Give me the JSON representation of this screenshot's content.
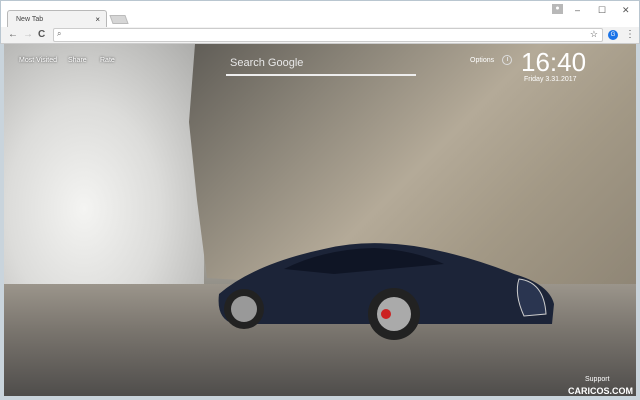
{
  "browser": {
    "tab_title": "New Tab",
    "tab_close": "×",
    "minimize": "–",
    "maximize": "☐",
    "close": "✕",
    "user_icon": "person-icon",
    "back": "←",
    "forward": "→",
    "reload": "C",
    "search_glyph": "🔍︎",
    "star": "☆",
    "ext_label": "G",
    "menu": "⋮",
    "address_value": ""
  },
  "page": {
    "nav": [
      "Most Visited",
      "Share",
      "Rate"
    ],
    "search_placeholder": "Search Google",
    "options": "Options",
    "time": "16:40",
    "date": "Friday  3.31.2017",
    "support": "Support",
    "brand": "CARICOS.COM"
  },
  "colors": {
    "car": "#1c2438",
    "accent": "#1a73e8"
  }
}
